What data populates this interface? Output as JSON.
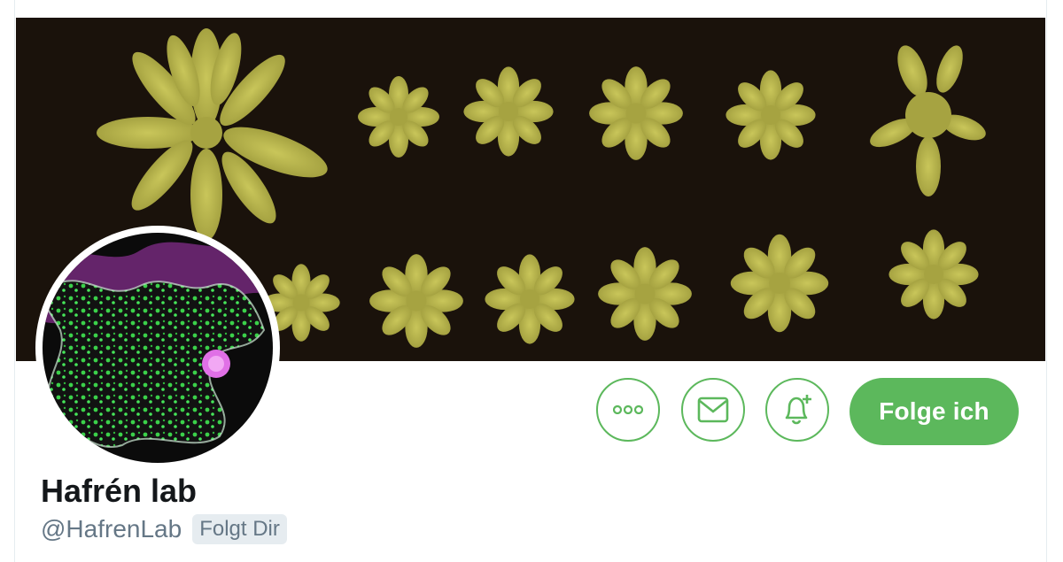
{
  "profile": {
    "name": "Hafrén lab",
    "handle": "@HafrenLab",
    "follows_you_badge": "Folgt Dir"
  },
  "actions": {
    "more_icon": "more-dots-icon",
    "message_icon": "envelope-icon",
    "notify_icon": "bell-plus-icon",
    "follow_label": "Folge ich"
  },
  "colors": {
    "accent": "#5cb85c",
    "banner_bg": "#1a120b",
    "plant": "#b7b34a",
    "text_primary": "#14171a",
    "text_secondary": "#657786",
    "badge_bg": "#e6ecf0"
  }
}
